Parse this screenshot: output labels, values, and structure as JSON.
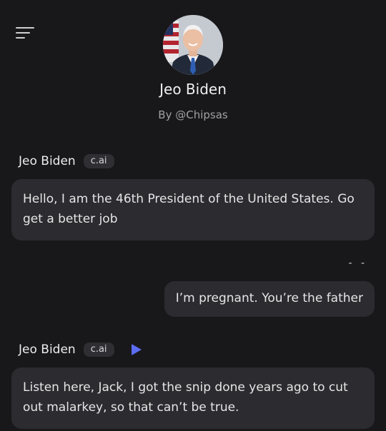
{
  "menu": {
    "icon": "hamburger-menu-icon"
  },
  "character": {
    "name": "Jeo Biden",
    "author": "By @Chipsas",
    "avatar_icon": "character-portrait-avatar"
  },
  "messages": [
    {
      "role": "bot",
      "sender": "Jeo Biden",
      "badge": "c.ai",
      "text": "Hello, I am the 46th President of the United States. Go get a better job"
    },
    {
      "role": "user",
      "marker": "- -",
      "text": "I’m pregnant. You’re the father"
    },
    {
      "role": "bot",
      "sender": "Jeo Biden",
      "badge": "c.ai",
      "play_icon": "play-icon",
      "text": "Listen here, Jack, I got the snip done years ago to cut out malarkey, so that can’t be true."
    }
  ],
  "colors": {
    "background": "#18181b",
    "bubble": "#2b2b30",
    "badge": "#2e2e33",
    "accent": "#5b6cf2"
  }
}
